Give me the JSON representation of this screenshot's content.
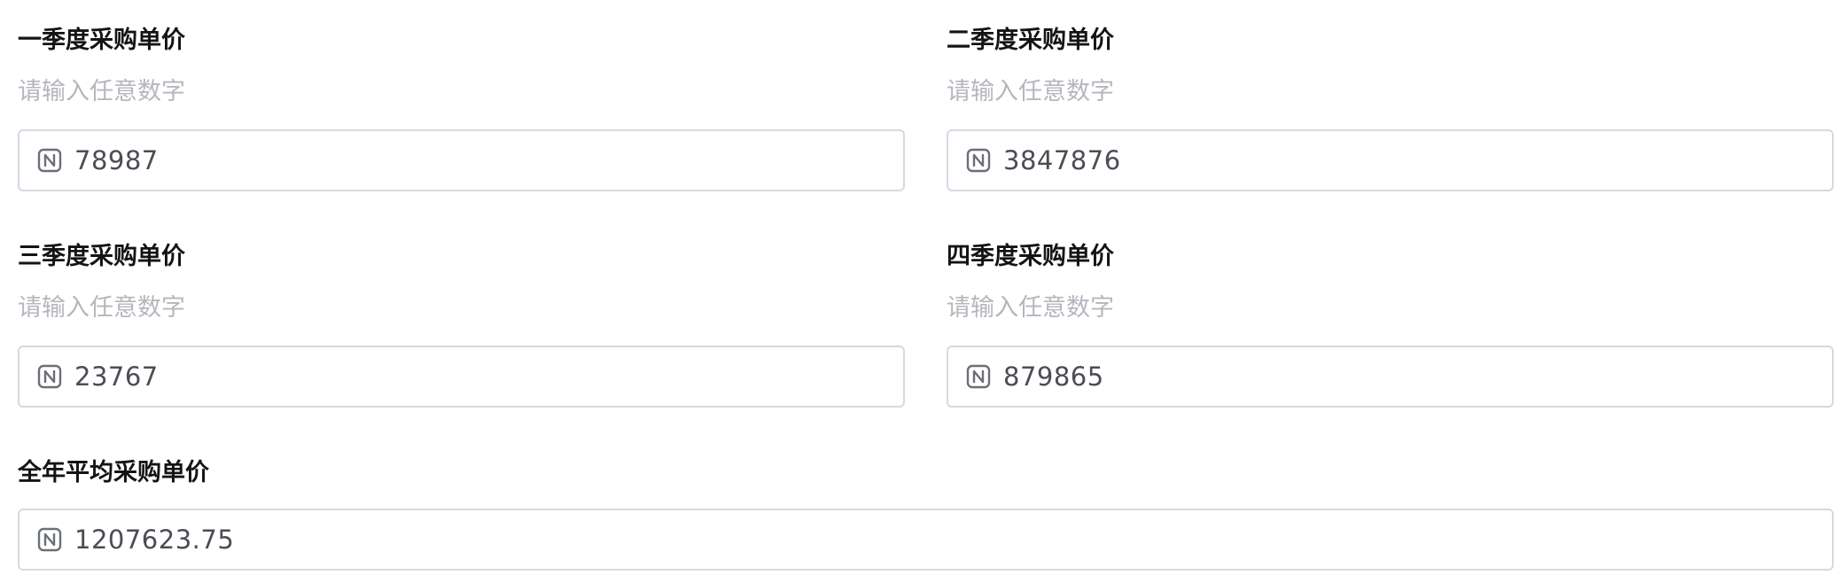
{
  "fields": [
    {
      "label": "一季度采购单价",
      "hint": "请输入任意数字",
      "value": "78987",
      "icon": "number-icon"
    },
    {
      "label": "二季度采购单价",
      "hint": "请输入任意数字",
      "value": "3847876",
      "icon": "number-icon"
    },
    {
      "label": "三季度采购单价",
      "hint": "请输入任意数字",
      "value": "23767",
      "icon": "number-icon"
    },
    {
      "label": "四季度采购单价",
      "hint": "请输入任意数字",
      "value": "879865",
      "icon": "number-icon"
    }
  ],
  "average": {
    "label": "全年平均采购单价",
    "value": "1207623.75",
    "icon": "number-icon"
  },
  "colors": {
    "label_text": "#141414",
    "hint_text": "#b4b7bd",
    "input_border": "#d5d9e2",
    "value_text": "#4a4d55",
    "icon_stroke": "#6b6f78"
  }
}
